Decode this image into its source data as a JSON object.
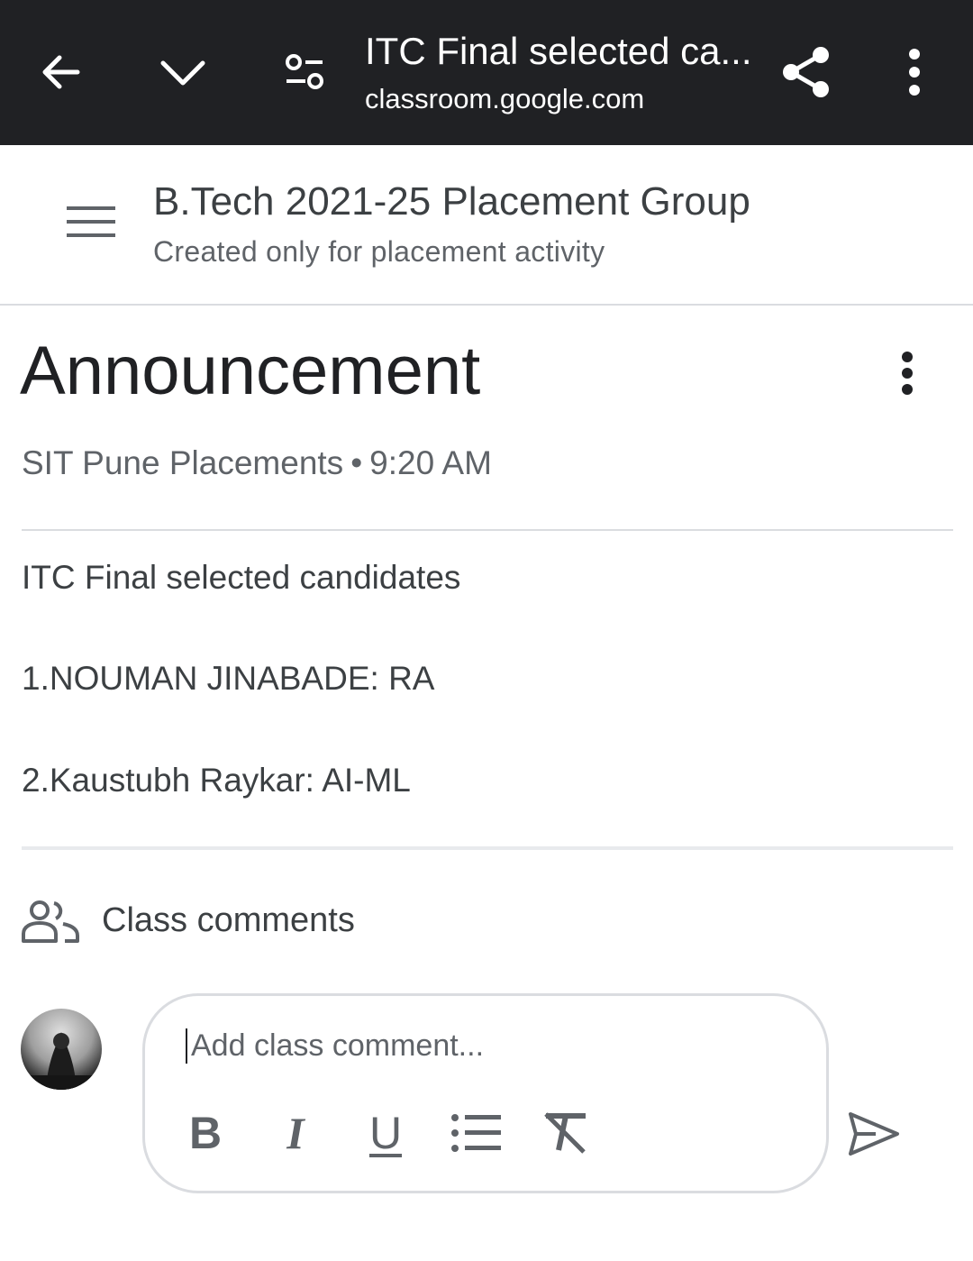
{
  "browser": {
    "tab_title": "ITC Final selected ca...",
    "url": "classroom.google.com",
    "icons": [
      "back-arrow-icon",
      "chevron-down-icon",
      "page-settings-icon",
      "share-icon",
      "more-vert-icon"
    ]
  },
  "class": {
    "name": "B.Tech 2021-25 Placement Group",
    "description": "Created only for placement activity"
  },
  "announcement": {
    "heading": "Announcement",
    "author": "SIT Pune Placements",
    "separator": "•",
    "time": "9:20 AM",
    "lines": [
      "ITC Final selected candidates",
      "1.NOUMAN JINABADE: RA",
      "2.Kaustubh Raykar: AI-ML"
    ]
  },
  "comments": {
    "label": "Class comments",
    "placeholder": "Add class comment...",
    "format_buttons": {
      "bold": "B",
      "italic": "I",
      "underline": "U"
    }
  },
  "colors": {
    "topbar_bg": "#202124",
    "text_primary": "#202124",
    "text_secondary": "#5f6368",
    "divider": "#dadce0"
  }
}
